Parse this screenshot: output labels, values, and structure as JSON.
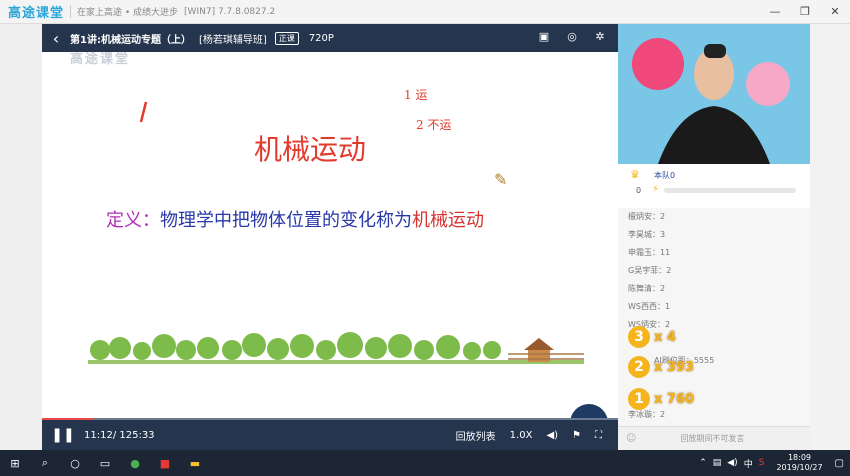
{
  "app": {
    "logo": "高途课堂",
    "slogan": "在家上高途 • 成绩大进步",
    "version": "[WIN7] 7.7.8.0827.2",
    "window_buttons": [
      "—",
      "❐",
      "✕"
    ]
  },
  "player": {
    "lesson_title": "第1讲:机械运动专题（上）",
    "teacher": "[杨若琪辅导班]",
    "badge": "正课",
    "resolution": "720P",
    "watermark": "高途课堂",
    "slide_title": "机械运动",
    "definition_label": "定义：",
    "definition_body": "物理学中把物体位置的变化称为",
    "definition_highlight": "机械运动",
    "annotation_1": "1 运",
    "annotation_2": "2 不运",
    "time": "11:12/ 125:33",
    "progress": 0.089,
    "playlist": "回放列表",
    "speed": "1.0X"
  },
  "side": {
    "team_name": "本队0",
    "team_score": "0",
    "ranking": [
      "檀炳安：2",
      "李昊城：3",
      "申霜玉：11",
      "G吴宇菲：2",
      "陈舞清：2",
      "WS西西：1",
      "WS炳安：2",
      "",
      "",
      "",
      "",
      "李冰璇：2"
    ],
    "extra_label": "AI刷位距：5555",
    "medals": [
      {
        "rank": "3",
        "count": "x 4"
      },
      {
        "rank": "2",
        "count": "x 393"
      },
      {
        "rank": "1",
        "count": "x 760"
      }
    ],
    "no_speak": "回放期间不可发言"
  },
  "taskbar": {
    "date": "2019/10/27",
    "time": "18:09",
    "ime": "中"
  }
}
